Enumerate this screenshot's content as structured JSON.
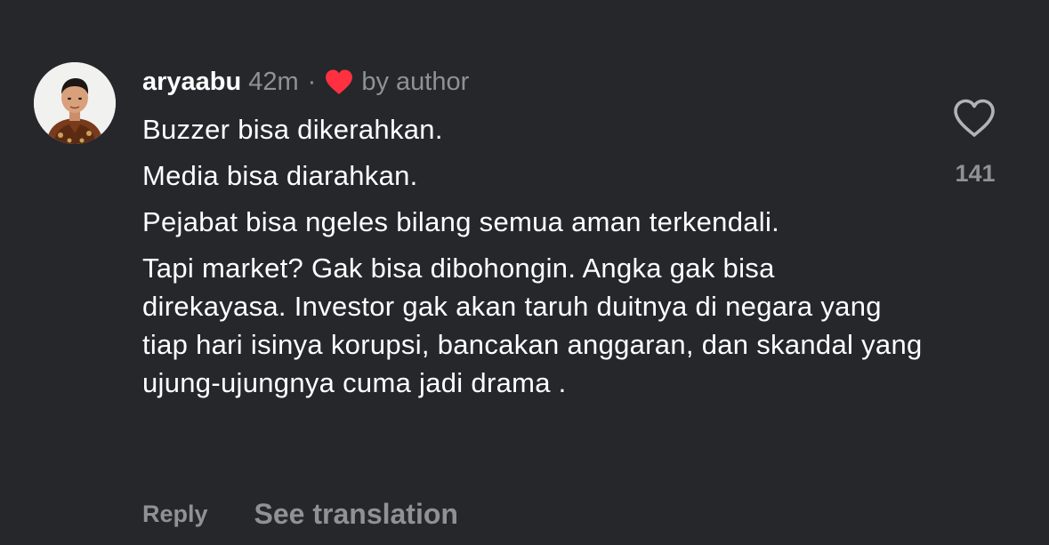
{
  "comment": {
    "username": "aryaabu",
    "time": "42m",
    "separator": "·",
    "author_badge": "by author",
    "paragraphs": [
      "Buzzer bisa dikerahkan.",
      "Media bisa diarahkan.",
      "Pejabat bisa ngeles bilang semua aman terkendali.",
      "Tapi market? Gak bisa dibohongin. Angka gak bisa direkayasa. Investor gak akan taruh duitnya di negara yang tiap hari isinya korupsi, bancakan anggaran, dan skandal yang ujung-ujungnya cuma jadi drama ."
    ],
    "like_count": "141",
    "actions": {
      "reply_label": "Reply",
      "translate_label": "See translation"
    },
    "icons": {
      "author_heart": "heart-filled-icon",
      "like": "heart-outline-icon"
    },
    "colors": {
      "background": "#25272b",
      "text_primary": "#ffffff",
      "text_secondary": "#8e9196",
      "heart_red": "#ff3040"
    }
  }
}
